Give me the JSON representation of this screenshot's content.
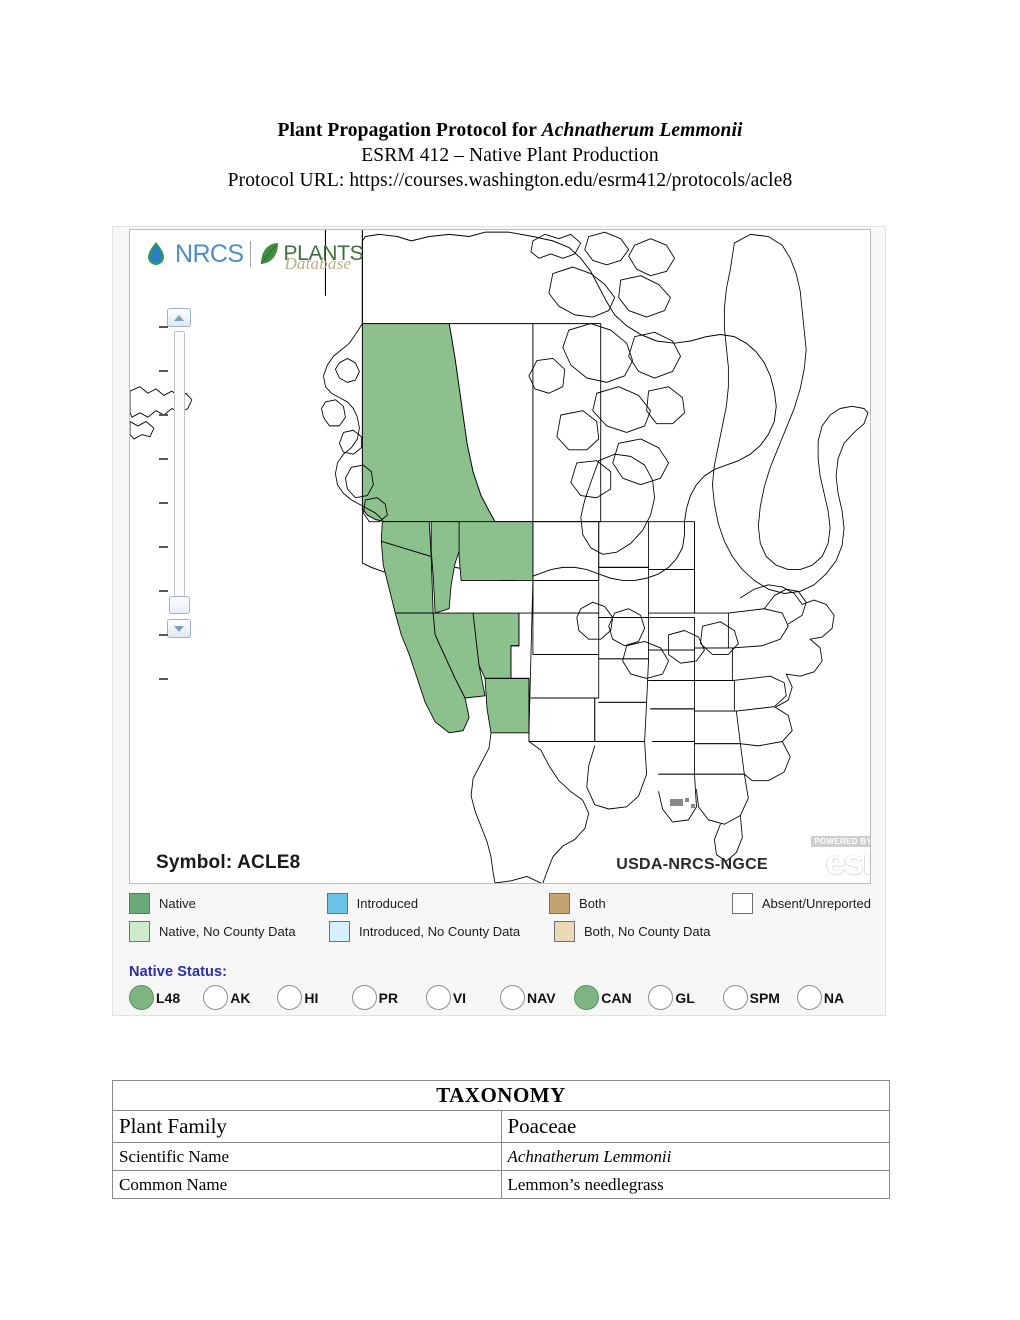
{
  "header": {
    "line1_prefix": "Plant Propagation Protocol for ",
    "line1_species": "Achnatherum Lemmonii",
    "line2": "ESRM 412 – Native Plant Production",
    "line3": "Protocol URL: https://courses.washington.edu/esrm412/protocols/acle8"
  },
  "map": {
    "logo": {
      "nrcs": "NRCS",
      "plants": "PLANTS",
      "database": "Database"
    },
    "symbol_label": "Symbol: ACLE8",
    "agency": "USDA-NRCS-NGCE",
    "esri_powered_by": "POWERED BY",
    "esri_mark": "esri",
    "green_fill": "#8cc08c",
    "outline": "#000000",
    "highlighted_regions": [
      "British Columbia",
      "Washington",
      "Oregon",
      "Idaho",
      "Montana",
      "California",
      "Nevada",
      "Utah",
      "Arizona"
    ]
  },
  "legend": {
    "rows": [
      [
        {
          "label": "Native",
          "color": "#6aaa78"
        },
        {
          "label": "Introduced",
          "color": "#6cc3e8"
        },
        {
          "label": "Both",
          "color": "#c4a373"
        },
        {
          "label": "Absent/Unreported",
          "color": "#ffffff"
        }
      ],
      [
        {
          "label": "Native, No County Data",
          "color": "#cdebcd"
        },
        {
          "label": "Introduced, No County Data",
          "color": "#d4f1fb"
        },
        {
          "label": "Both, No County Data",
          "color": "#ead9b6"
        }
      ]
    ]
  },
  "native_status": {
    "title": "Native Status:",
    "items": [
      {
        "label": "L48",
        "active": true
      },
      {
        "label": "AK",
        "active": false
      },
      {
        "label": "HI",
        "active": false
      },
      {
        "label": "PR",
        "active": false
      },
      {
        "label": "VI",
        "active": false
      },
      {
        "label": "NAV",
        "active": false
      },
      {
        "label": "CAN",
        "active": true
      },
      {
        "label": "GL",
        "active": false
      },
      {
        "label": "SPM",
        "active": false
      },
      {
        "label": "NA",
        "active": false
      }
    ],
    "active_color": "#7fb583"
  },
  "taxonomy": {
    "title": "TAXONOMY",
    "rows": [
      {
        "label": "Plant Family",
        "value": "Poaceae",
        "size": "big",
        "italic": false
      },
      {
        "label": "Scientific Name",
        "value": "Achnatherum Lemmonii",
        "size": "sm",
        "italic": true
      },
      {
        "label": "Common Name",
        "value": "Lemmon’s needlegrass",
        "size": "sm",
        "italic": false
      }
    ]
  }
}
